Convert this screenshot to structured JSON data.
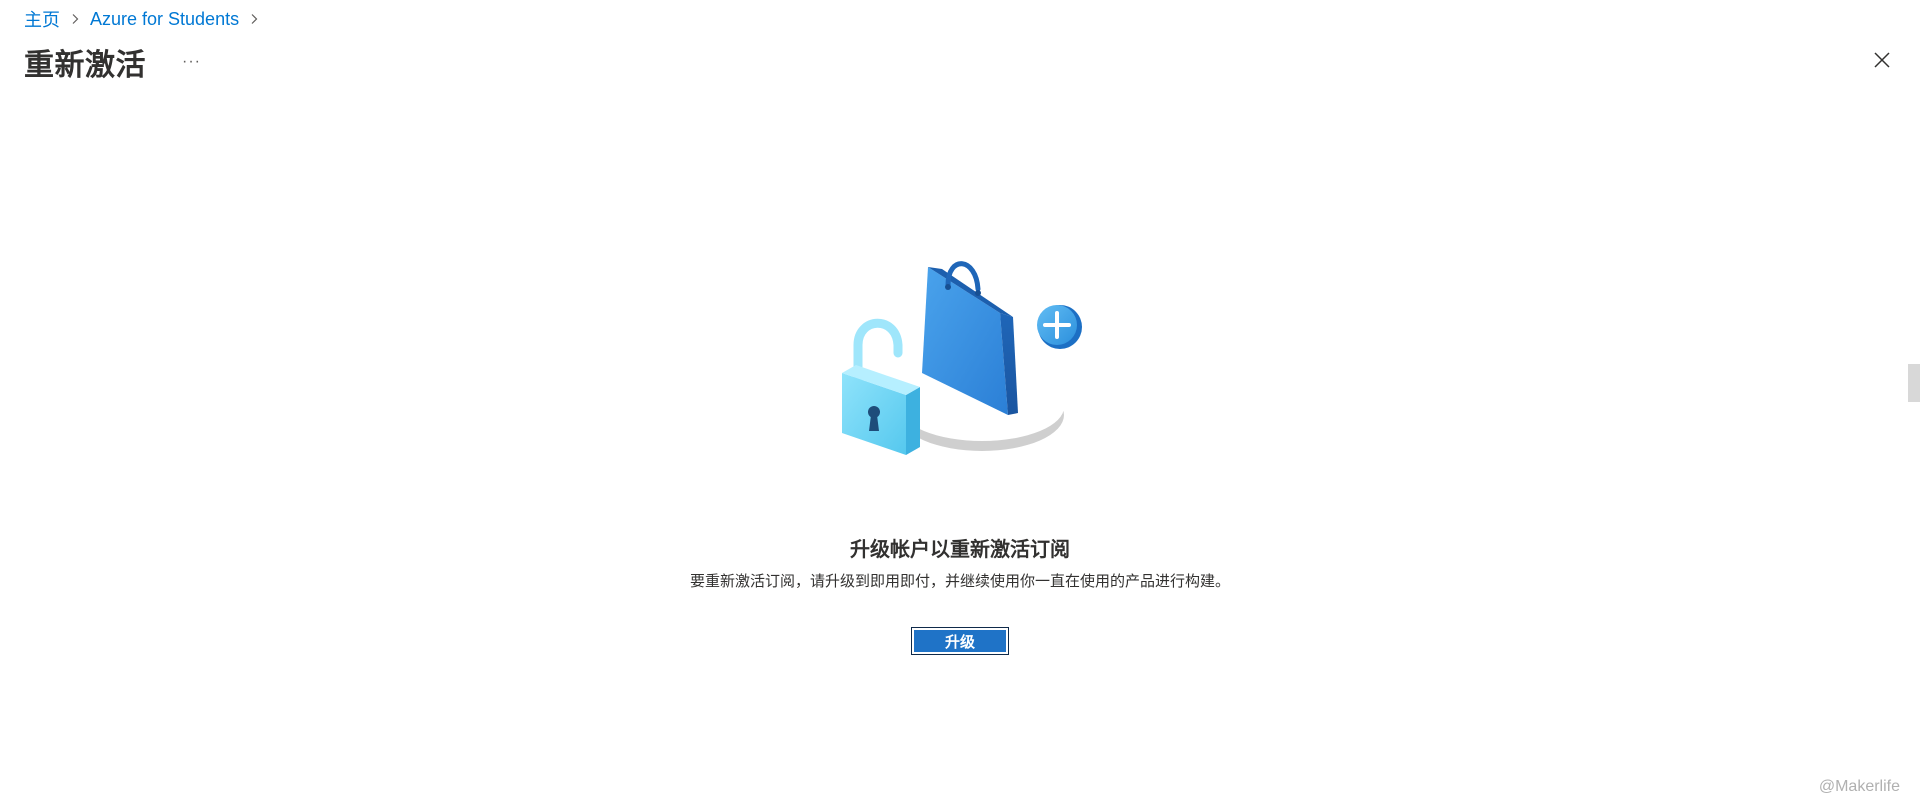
{
  "breadcrumb": {
    "items": [
      "主页",
      "Azure for Students"
    ]
  },
  "header": {
    "title": "重新激活",
    "more_label": "···"
  },
  "main": {
    "heading": "升级帐户以重新激活订阅",
    "description": "要重新激活订阅，请升级到即用即付，并继续使用你一直在使用的产品进行构建。",
    "upgrade_label": "升级"
  },
  "watermark": "@Makerlife",
  "icons": {
    "close": "close-icon",
    "chevron": "chevron-right-icon",
    "illustration": "upgrade-illustration"
  },
  "colors": {
    "link": "#0078d4",
    "primary_button": "#1f73c7",
    "text": "#323130"
  }
}
